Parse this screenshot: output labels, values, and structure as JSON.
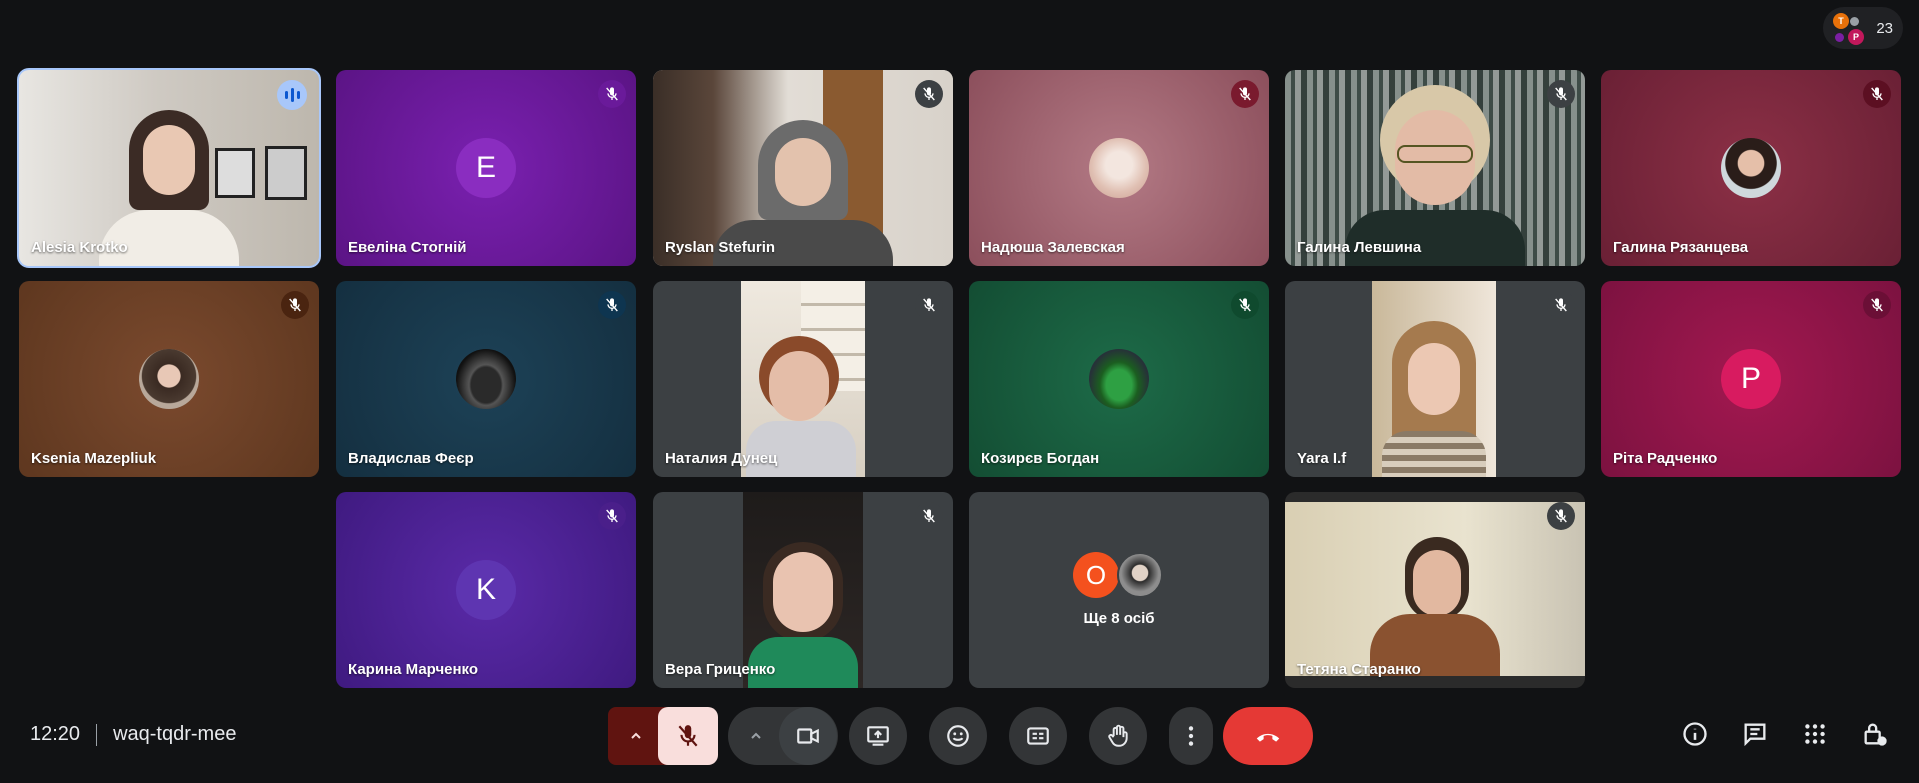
{
  "participants_count": "23",
  "mini_avatars": [
    {
      "letter": "T",
      "color": "#e8710a"
    },
    {
      "letter": "P",
      "color": "#c2185b"
    },
    {
      "letter": "",
      "color": "#5f6368"
    },
    {
      "letter": "",
      "color": "#7b1fa2"
    }
  ],
  "tiles": [
    {
      "name": "Alesia Krotko",
      "mic": "speaking"
    },
    {
      "name": "Евеліна Стогній",
      "mic": "muted",
      "avatar_letter": "E"
    },
    {
      "name": "Ryslan Stefurin",
      "mic": "muted"
    },
    {
      "name": "Надюша Залевская",
      "mic": "muted"
    },
    {
      "name": "Галина Левшина",
      "mic": "muted"
    },
    {
      "name": "Галина Рязанцева",
      "mic": "muted"
    },
    {
      "name": "Ksenia Mazepliuk",
      "mic": "muted"
    },
    {
      "name": "Владислав Феєр",
      "mic": "muted"
    },
    {
      "name": "Наталия Дунец",
      "mic": "muted"
    },
    {
      "name": "Козирєв Богдан",
      "mic": "muted"
    },
    {
      "name": "Yara I.f",
      "mic": "muted"
    },
    {
      "name": "Ріта Радченко",
      "mic": "muted",
      "avatar_letter": "P"
    },
    {
      "name": "Карина Марченко",
      "mic": "muted",
      "avatar_letter": "K"
    },
    {
      "name": "Вера Гриценко",
      "mic": "muted"
    },
    {
      "name": "Ще 8 осіб",
      "avatar_letter": "O"
    },
    {
      "name": "Тетяна Старанко",
      "mic": "muted"
    }
  ],
  "meeting": {
    "time": "12:20",
    "code": "waq-tqdr-mee"
  },
  "colors": {
    "end_call": "#e53935",
    "mic_off_bg": "#f9dedc",
    "mic_chevron_bg": "#601410"
  }
}
